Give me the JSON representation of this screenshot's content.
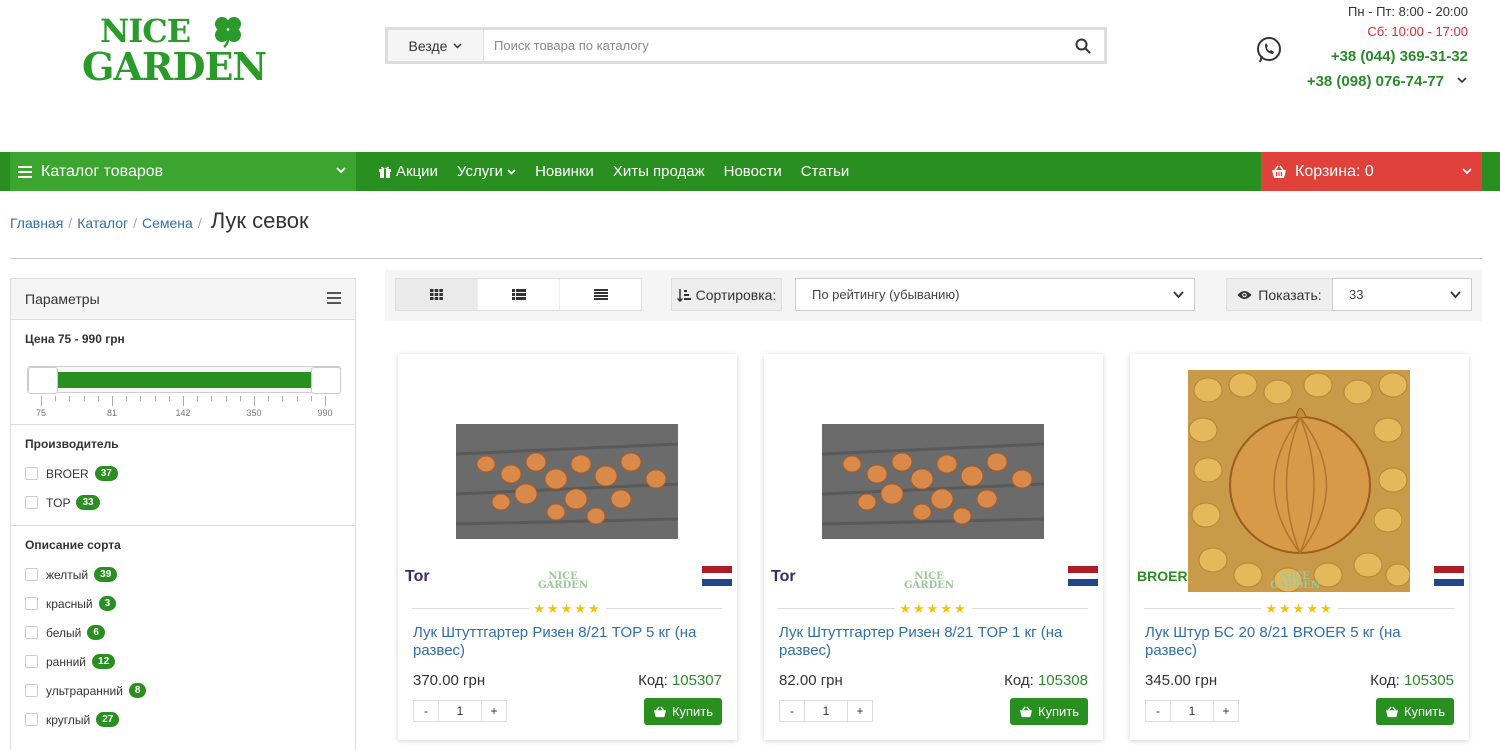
{
  "header": {
    "logo_line1": "NICE",
    "logo_line2": "GARDEN",
    "search_scope": "Везде",
    "search_placeholder": "Поиск товара по каталогу",
    "hours_weekdays": "Пн - Пт: 8:00 - 20:00",
    "hours_saturday": "Сб: 10:00 - 17:00",
    "phone1": "+38 (044) 369-31-32",
    "phone2": "+38 (098) 076-74-77"
  },
  "nav": {
    "catalog_label": "Каталог товаров",
    "items": [
      "Акции",
      "Услуги",
      "Новинки",
      "Хиты продаж",
      "Новости",
      "Статьи"
    ],
    "cart_label": "Корзина: 0"
  },
  "breadcrumb": {
    "items": [
      "Главная",
      "Каталог",
      "Семена"
    ],
    "current": "Лук севок"
  },
  "sidebar": {
    "title": "Параметры",
    "price_title": "Цена  75 - 990 грн",
    "price_ticks": [
      "75",
      "81",
      "142",
      "350",
      "990"
    ],
    "manufacturer_title": "Производитель",
    "manufacturers": [
      {
        "label": "BROER",
        "count": "37"
      },
      {
        "label": "TOP",
        "count": "33"
      }
    ],
    "variety_title": "Описание сорта",
    "varieties": [
      {
        "label": "желтый",
        "count": "39"
      },
      {
        "label": "красный",
        "count": "3"
      },
      {
        "label": "белый",
        "count": "6"
      },
      {
        "label": "ранний",
        "count": "12"
      },
      {
        "label": "ультраранний",
        "count": "8"
      },
      {
        "label": "круглый",
        "count": "27"
      }
    ]
  },
  "toolbar": {
    "sort_label": "Сортировка:",
    "sort_value": "По рейтингу (убыванию)",
    "show_label": "Показать:",
    "show_value": "33"
  },
  "products": [
    {
      "brand": "Tor",
      "wm1": "NICE",
      "wm2": "GARDEN",
      "stars": "★★★★★",
      "name": "Лук Штуттгартер Ризен 8/21 TOP 5 кг (на развес)",
      "price": "370.00 грн",
      "code_label": "Код:",
      "code": "105307",
      "qty": "1",
      "minus": "-",
      "plus": "+",
      "buy": "Купить"
    },
    {
      "brand": "Tor",
      "wm1": "NICE",
      "wm2": "GARDEN",
      "stars": "★★★★★",
      "name": "Лук Штуттгартер Ризен 8/21 TOP 1 кг (на развес)",
      "price": "82.00 грн",
      "code_label": "Код:",
      "code": "105308",
      "qty": "1",
      "minus": "-",
      "plus": "+",
      "buy": "Купить"
    },
    {
      "brand": "BROER",
      "wm1": "NICE",
      "wm2": "GARDEN",
      "stars": "★★★★★",
      "name": "Лук Штур БС 20 8/21 BROER 5 кг (на развес)",
      "price": "345.00 грн",
      "code_label": "Код:",
      "code": "105305",
      "qty": "1",
      "minus": "-",
      "plus": "+",
      "buy": "Купить"
    }
  ],
  "colors": {
    "brand_green": "#2a8f21",
    "cart_red": "#e0413a",
    "link_blue": "#2f6fab",
    "star_yellow": "#f4c20d"
  }
}
